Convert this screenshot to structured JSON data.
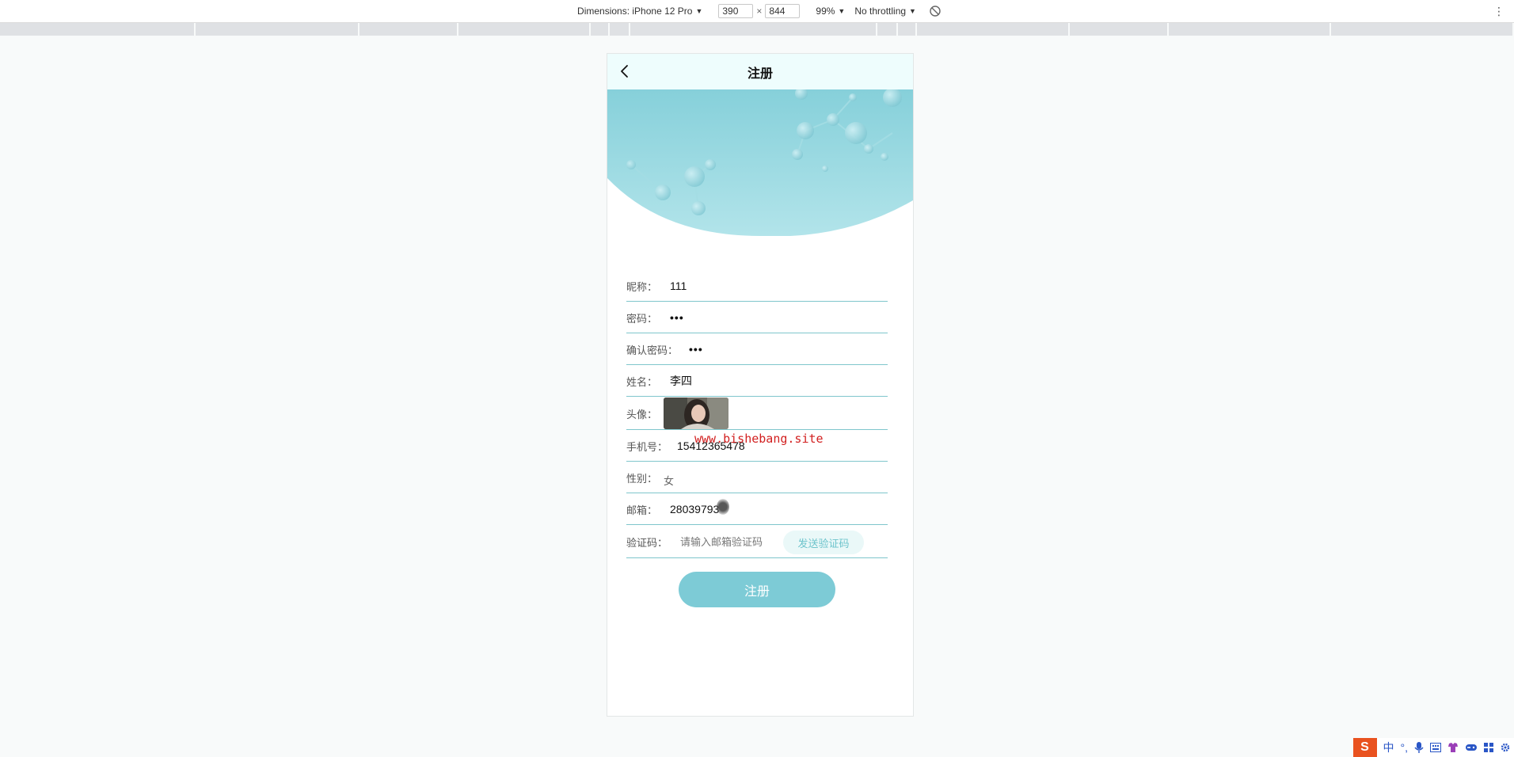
{
  "devtools": {
    "dimensions_label": "Dimensions: iPhone 12 Pro",
    "width_value": "390",
    "times": "×",
    "height_value": "844",
    "zoom": "99%",
    "throttling": "No throttling"
  },
  "page": {
    "title": "注册"
  },
  "form": {
    "nickname_label": "昵称：",
    "nickname_value": "111",
    "password_label": "密码：",
    "password_value": "•••",
    "confirm_password_label": "确认密码：",
    "confirm_password_value": "•••",
    "name_label": "姓名：",
    "name_value": "李四",
    "avatar_label": "头像：",
    "phone_label": "手机号：",
    "phone_value": "15412365478",
    "gender_label": "性别：",
    "gender_value": "女",
    "email_label": "邮箱：",
    "email_value": "28039793",
    "code_label": "验证码：",
    "code_placeholder": "请输入邮箱验证码",
    "send_code_label": "发送验证码",
    "submit_label": "注册"
  },
  "watermark": "www.bishebang.site",
  "ime": {
    "logo": "S",
    "mode": "中",
    "punct": "°,"
  },
  "colors": {
    "accent": "#7dcbd6",
    "underline": "#7fc6cc",
    "nav_bg": "#eefdfd",
    "watermark": "#d22020"
  }
}
